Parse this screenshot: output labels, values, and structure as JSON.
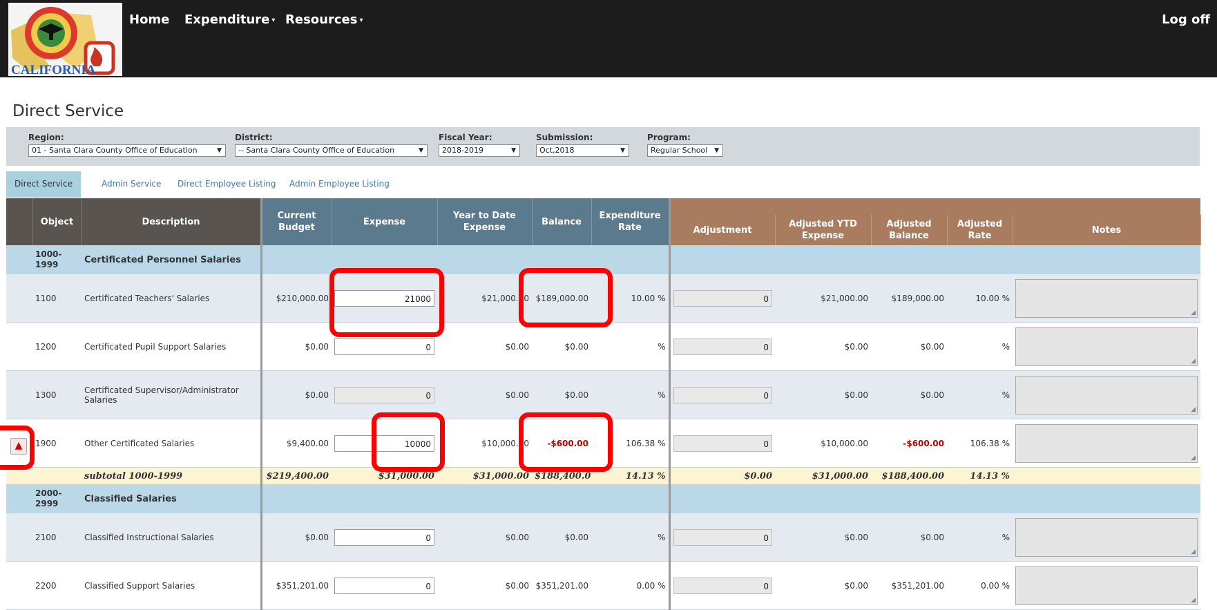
{
  "nav": {
    "logo_text": "CALIFORNIA",
    "home": "Home",
    "expenditure": "Expenditure",
    "resources": "Resources",
    "logoff": "Log off"
  },
  "page_title": "Direct Service",
  "filters": {
    "region_label": "Region:",
    "region_value": "01 - Santa Clara County Office of Education",
    "district_label": "District:",
    "district_value": "-- Santa Clara County Office of Education",
    "fiscal_year_label": "Fiscal Year:",
    "fiscal_year_value": "2018-2019",
    "submission_label": "Submission:",
    "submission_value": "Oct,2018",
    "program_label": "Program:",
    "program_value": "Regular School"
  },
  "tabs": [
    "Direct Service",
    "Admin Service",
    "Direct Employee Listing",
    "Admin Employee Listing"
  ],
  "columns": {
    "object": "Object",
    "description": "Description",
    "current_budget": "Current Budget",
    "expense": "Expense",
    "ytd_expense": "Year to Date Expense",
    "balance": "Balance",
    "expenditure_rate": "Expenditure Rate",
    "adjustment": "Adjustment",
    "adjusted_ytd": "Adjusted YTD Expense",
    "adjusted_balance": "Adjusted Balance",
    "adjusted_rate": "Adjusted Rate",
    "notes": "Notes"
  },
  "sections": [
    {
      "code": "1000-1999",
      "title": "Certificated Personnel Salaries",
      "rows": [
        {
          "object": "1100",
          "description": "Certificated Teachers' Salaries",
          "budget": "$210,000.00",
          "expense": "21000",
          "ytd": "$21,000.00",
          "balance": "$189,000.00",
          "rate": "10.00 %",
          "adjustment": "0",
          "adj_ytd": "$21,000.00",
          "adj_balance": "$189,000.00",
          "adj_rate": "10.00 %"
        },
        {
          "object": "1200",
          "description": "Certificated Pupil Support Salaries",
          "budget": "$0.00",
          "expense": "0",
          "ytd": "$0.00",
          "balance": "$0.00",
          "rate": "%",
          "adjustment": "0",
          "adj_ytd": "$0.00",
          "adj_balance": "$0.00",
          "adj_rate": "%"
        },
        {
          "object": "1300",
          "description": "Certificated Supervisor/Administrator Salaries",
          "budget": "$0.00",
          "expense": "0",
          "ytd": "$0.00",
          "balance": "$0.00",
          "rate": "%",
          "adjustment": "0",
          "adj_ytd": "$0.00",
          "adj_balance": "$0.00",
          "adj_rate": "%"
        },
        {
          "object": "1900",
          "description": "Other Certificated Salaries",
          "budget": "$9,400.00",
          "expense": "10000",
          "ytd": "$10,000.00",
          "balance": "-$600.00",
          "rate": "106.38 %",
          "adjustment": "0",
          "adj_ytd": "$10,000.00",
          "adj_balance": "-$600.00",
          "adj_rate": "106.38 %"
        }
      ],
      "subtotal": {
        "label": "subtotal 1000-1999",
        "budget": "$219,400.00",
        "expense": "$31,000.00",
        "ytd": "$31,000.00",
        "balance": "$188,400.00",
        "rate": "14.13 %",
        "adjustment": "$0.00",
        "adj_ytd": "$31,000.00",
        "adj_balance": "$188,400.00",
        "adj_rate": "14.13 %"
      }
    },
    {
      "code": "2000-2999",
      "title": "Classified Salaries",
      "rows": [
        {
          "object": "2100",
          "description": "Classified Instructional Salaries",
          "budget": "$0.00",
          "expense": "0",
          "ytd": "$0.00",
          "balance": "$0.00",
          "rate": "%",
          "adjustment": "0",
          "adj_ytd": "$0.00",
          "adj_balance": "$0.00",
          "adj_rate": "%"
        },
        {
          "object": "2200",
          "description": "Classified Support Salaries",
          "budget": "$351,201.00",
          "expense": "0",
          "ytd": "$0.00",
          "balance": "$351,201.00",
          "rate": "0.00 %",
          "adjustment": "0",
          "adj_ytd": "$0.00",
          "adj_balance": "$351,201.00",
          "adj_rate": "0.00 %"
        }
      ]
    }
  ],
  "colors": {
    "highlight": "#ff0000",
    "negative": "#c00000",
    "header_blue": "#5b7a8e",
    "header_brown": "#a97c5f"
  }
}
